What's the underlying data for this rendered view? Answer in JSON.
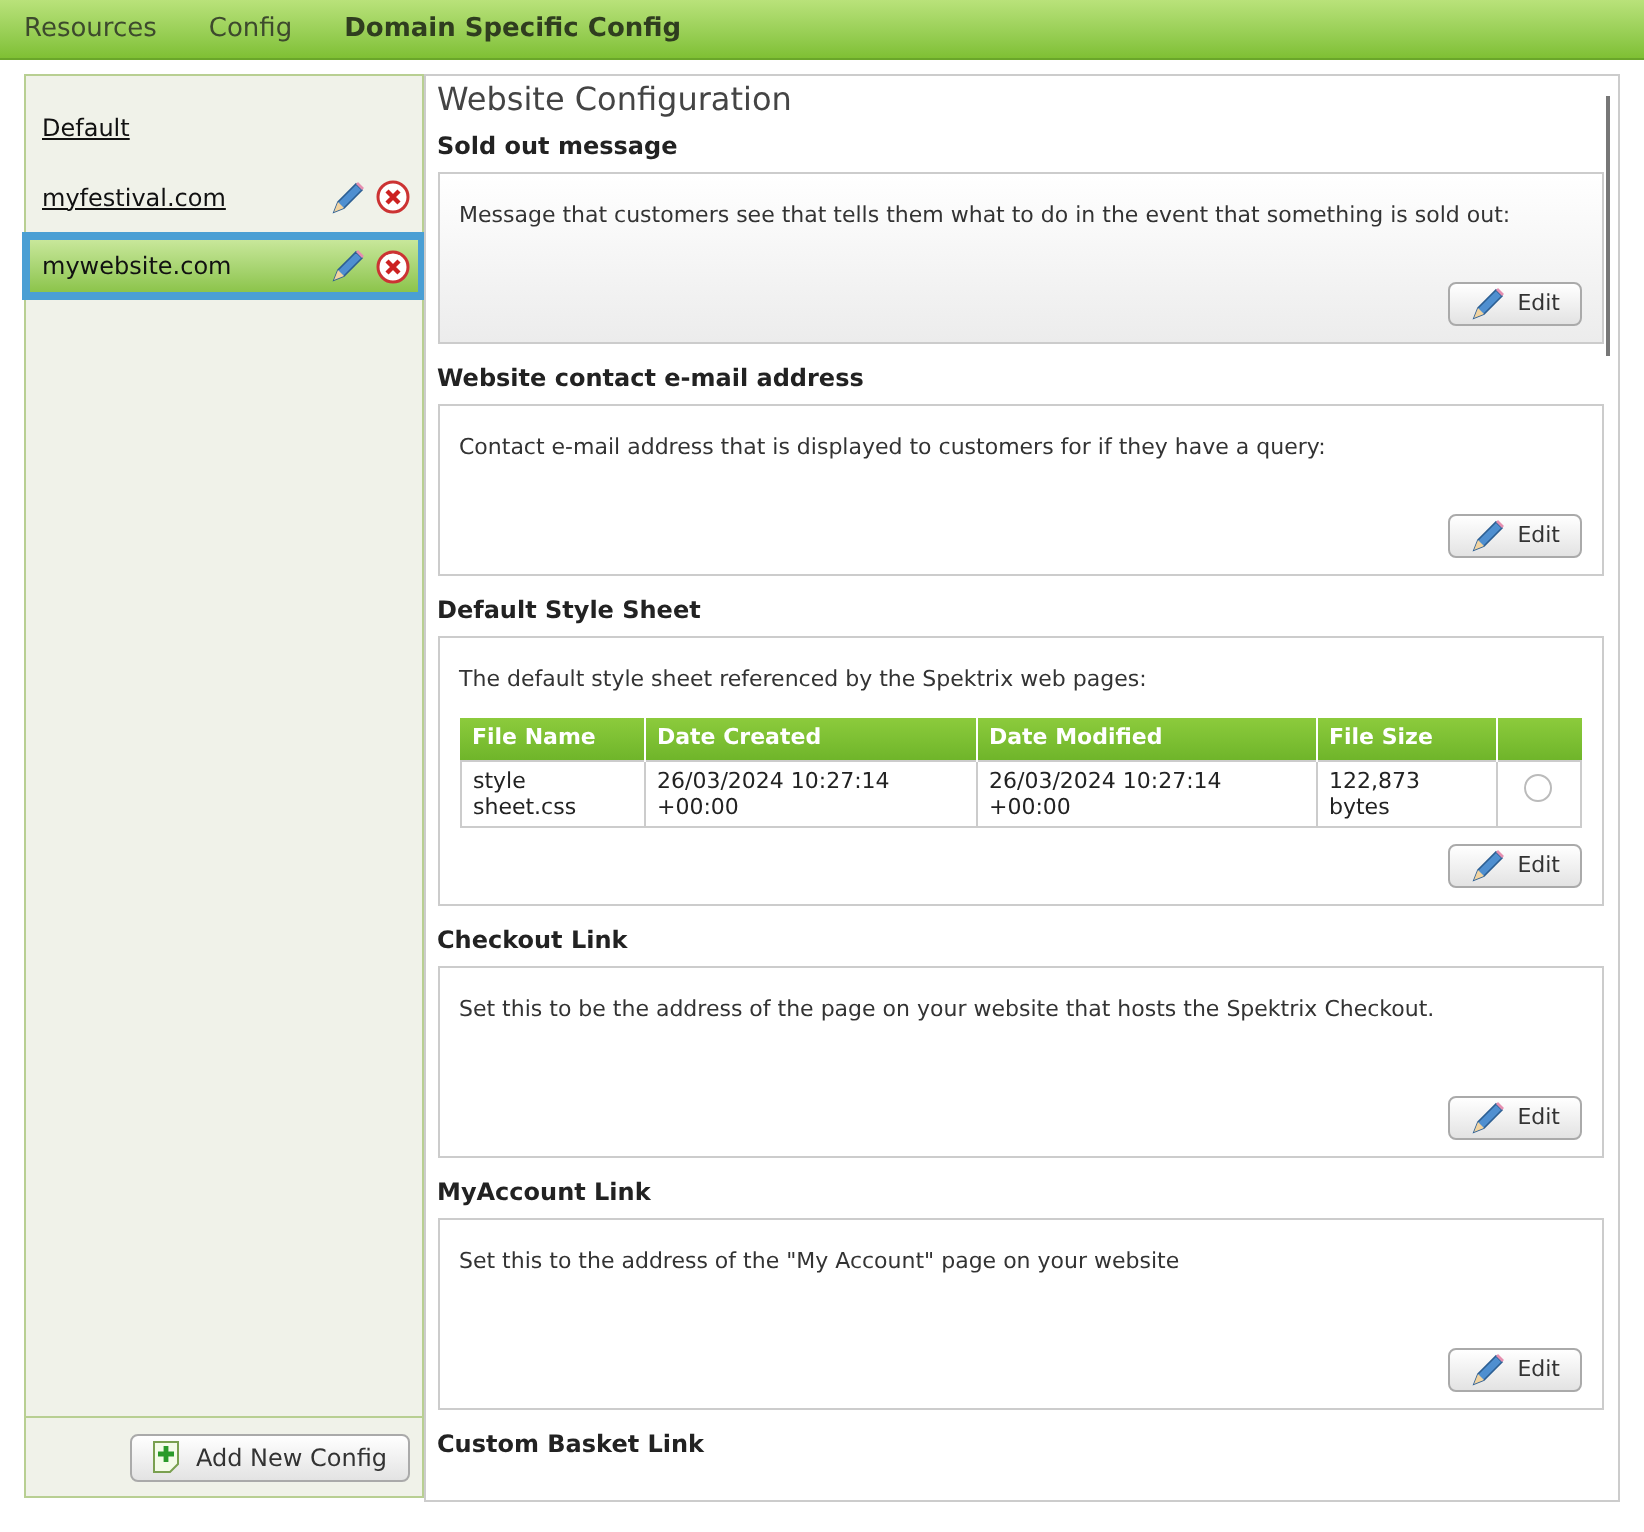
{
  "tabs": [
    {
      "label": "Resources",
      "selected": false
    },
    {
      "label": "Config",
      "selected": false
    },
    {
      "label": "Domain Specific Config",
      "selected": true
    }
  ],
  "sidebar": {
    "items": [
      {
        "label": "Default",
        "selected": false,
        "actions": false
      },
      {
        "label": "myfestival.com",
        "selected": false,
        "actions": true
      },
      {
        "label": "mywebsite.com",
        "selected": true,
        "actions": true
      }
    ],
    "add_button": "Add New Config"
  },
  "content": {
    "title": "Website Configuration",
    "sections": [
      {
        "title": "Sold out message",
        "description": "Message that customers see that tells them what to do in the event that something is sold out:",
        "highlighted": true,
        "button": "Edit"
      },
      {
        "title": "Website contact e-mail address",
        "description": "Contact e-mail address that is displayed to customers for if they have a query:",
        "highlighted": false,
        "button": "Edit"
      },
      {
        "title": "Default Style Sheet",
        "description": "The default style sheet referenced by the Spektrix web pages:",
        "highlighted": false,
        "button": "Edit",
        "table": {
          "columns": [
            "File Name",
            "Date Created",
            "Date Modified",
            "File Size"
          ],
          "rows": [
            {
              "cells": [
                "style sheet.css",
                "26/03/2024 10:27:14 +00:00",
                "26/03/2024 10:27:14 +00:00",
                "122,873 bytes"
              ],
              "selected": false
            }
          ]
        }
      },
      {
        "title": "Checkout Link",
        "description": "Set this to be the address of the page on your website that hosts the Spektrix Checkout.",
        "highlighted": false,
        "button": "Edit"
      },
      {
        "title": "MyAccount Link",
        "description": "Set this to the address of the \"My Account\" page on your website",
        "highlighted": false,
        "button": "Edit"
      },
      {
        "title": "Custom Basket Link"
      }
    ]
  }
}
